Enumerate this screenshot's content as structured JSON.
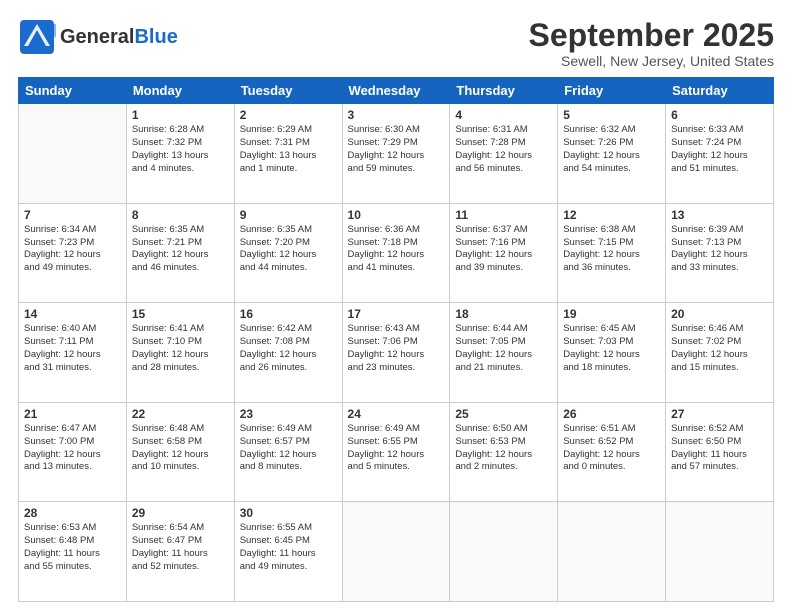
{
  "header": {
    "logo_general": "General",
    "logo_blue": "Blue",
    "month": "September 2025",
    "location": "Sewell, New Jersey, United States"
  },
  "weekdays": [
    "Sunday",
    "Monday",
    "Tuesday",
    "Wednesday",
    "Thursday",
    "Friday",
    "Saturday"
  ],
  "weeks": [
    [
      {
        "day": "",
        "info": ""
      },
      {
        "day": "1",
        "info": "Sunrise: 6:28 AM\nSunset: 7:32 PM\nDaylight: 13 hours\nand 4 minutes."
      },
      {
        "day": "2",
        "info": "Sunrise: 6:29 AM\nSunset: 7:31 PM\nDaylight: 13 hours\nand 1 minute."
      },
      {
        "day": "3",
        "info": "Sunrise: 6:30 AM\nSunset: 7:29 PM\nDaylight: 12 hours\nand 59 minutes."
      },
      {
        "day": "4",
        "info": "Sunrise: 6:31 AM\nSunset: 7:28 PM\nDaylight: 12 hours\nand 56 minutes."
      },
      {
        "day": "5",
        "info": "Sunrise: 6:32 AM\nSunset: 7:26 PM\nDaylight: 12 hours\nand 54 minutes."
      },
      {
        "day": "6",
        "info": "Sunrise: 6:33 AM\nSunset: 7:24 PM\nDaylight: 12 hours\nand 51 minutes."
      }
    ],
    [
      {
        "day": "7",
        "info": "Sunrise: 6:34 AM\nSunset: 7:23 PM\nDaylight: 12 hours\nand 49 minutes."
      },
      {
        "day": "8",
        "info": "Sunrise: 6:35 AM\nSunset: 7:21 PM\nDaylight: 12 hours\nand 46 minutes."
      },
      {
        "day": "9",
        "info": "Sunrise: 6:35 AM\nSunset: 7:20 PM\nDaylight: 12 hours\nand 44 minutes."
      },
      {
        "day": "10",
        "info": "Sunrise: 6:36 AM\nSunset: 7:18 PM\nDaylight: 12 hours\nand 41 minutes."
      },
      {
        "day": "11",
        "info": "Sunrise: 6:37 AM\nSunset: 7:16 PM\nDaylight: 12 hours\nand 39 minutes."
      },
      {
        "day": "12",
        "info": "Sunrise: 6:38 AM\nSunset: 7:15 PM\nDaylight: 12 hours\nand 36 minutes."
      },
      {
        "day": "13",
        "info": "Sunrise: 6:39 AM\nSunset: 7:13 PM\nDaylight: 12 hours\nand 33 minutes."
      }
    ],
    [
      {
        "day": "14",
        "info": "Sunrise: 6:40 AM\nSunset: 7:11 PM\nDaylight: 12 hours\nand 31 minutes."
      },
      {
        "day": "15",
        "info": "Sunrise: 6:41 AM\nSunset: 7:10 PM\nDaylight: 12 hours\nand 28 minutes."
      },
      {
        "day": "16",
        "info": "Sunrise: 6:42 AM\nSunset: 7:08 PM\nDaylight: 12 hours\nand 26 minutes."
      },
      {
        "day": "17",
        "info": "Sunrise: 6:43 AM\nSunset: 7:06 PM\nDaylight: 12 hours\nand 23 minutes."
      },
      {
        "day": "18",
        "info": "Sunrise: 6:44 AM\nSunset: 7:05 PM\nDaylight: 12 hours\nand 21 minutes."
      },
      {
        "day": "19",
        "info": "Sunrise: 6:45 AM\nSunset: 7:03 PM\nDaylight: 12 hours\nand 18 minutes."
      },
      {
        "day": "20",
        "info": "Sunrise: 6:46 AM\nSunset: 7:02 PM\nDaylight: 12 hours\nand 15 minutes."
      }
    ],
    [
      {
        "day": "21",
        "info": "Sunrise: 6:47 AM\nSunset: 7:00 PM\nDaylight: 12 hours\nand 13 minutes."
      },
      {
        "day": "22",
        "info": "Sunrise: 6:48 AM\nSunset: 6:58 PM\nDaylight: 12 hours\nand 10 minutes."
      },
      {
        "day": "23",
        "info": "Sunrise: 6:49 AM\nSunset: 6:57 PM\nDaylight: 12 hours\nand 8 minutes."
      },
      {
        "day": "24",
        "info": "Sunrise: 6:49 AM\nSunset: 6:55 PM\nDaylight: 12 hours\nand 5 minutes."
      },
      {
        "day": "25",
        "info": "Sunrise: 6:50 AM\nSunset: 6:53 PM\nDaylight: 12 hours\nand 2 minutes."
      },
      {
        "day": "26",
        "info": "Sunrise: 6:51 AM\nSunset: 6:52 PM\nDaylight: 12 hours\nand 0 minutes."
      },
      {
        "day": "27",
        "info": "Sunrise: 6:52 AM\nSunset: 6:50 PM\nDaylight: 11 hours\nand 57 minutes."
      }
    ],
    [
      {
        "day": "28",
        "info": "Sunrise: 6:53 AM\nSunset: 6:48 PM\nDaylight: 11 hours\nand 55 minutes."
      },
      {
        "day": "29",
        "info": "Sunrise: 6:54 AM\nSunset: 6:47 PM\nDaylight: 11 hours\nand 52 minutes."
      },
      {
        "day": "30",
        "info": "Sunrise: 6:55 AM\nSunset: 6:45 PM\nDaylight: 11 hours\nand 49 minutes."
      },
      {
        "day": "",
        "info": ""
      },
      {
        "day": "",
        "info": ""
      },
      {
        "day": "",
        "info": ""
      },
      {
        "day": "",
        "info": ""
      }
    ]
  ]
}
